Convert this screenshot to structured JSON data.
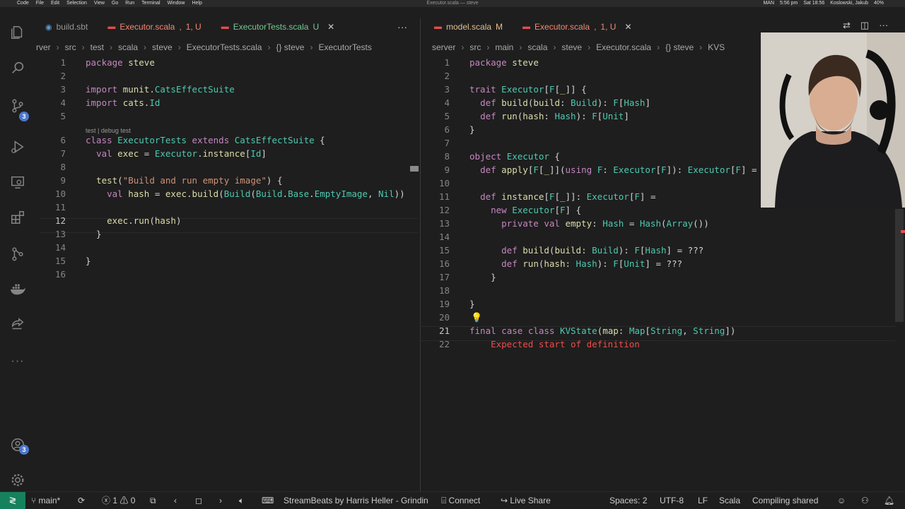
{
  "macbar": {
    "app": "Code",
    "menus": [
      "File",
      "Edit",
      "Selection",
      "View",
      "Go",
      "Run",
      "Terminal",
      "Window",
      "Help"
    ],
    "window_title": "Executor.scala — steve",
    "tray": [
      "MAN",
      "5:56 pm",
      "Sat 18:56",
      "Koslowski, Jakub",
      "40%"
    ]
  },
  "left_editor": {
    "tabs": [
      {
        "label": "build.sbt",
        "icon": "sbt-icon",
        "color": "#969696"
      },
      {
        "label": "Executor.scala",
        "status": "1, U",
        "color": "#f48771"
      },
      {
        "label": "ExecutorTests.scala",
        "status": "U",
        "color": "#73c991"
      }
    ],
    "breadcrumb": [
      "rver",
      "src",
      "test",
      "scala",
      "steve",
      "ExecutorTests.scala",
      "{} steve",
      "ExecutorTests"
    ],
    "codelens": "test | debug test",
    "lines": [
      {
        "n": "1",
        "text": "package steve"
      },
      {
        "n": "2",
        "text": ""
      },
      {
        "n": "3",
        "text": "import munit.CatsEffectSuite"
      },
      {
        "n": "4",
        "text": "import cats.Id"
      },
      {
        "n": "5",
        "text": ""
      },
      {
        "n": "6",
        "text": "class ExecutorTests extends CatsEffectSuite {"
      },
      {
        "n": "7",
        "text": "  val exec = Executor.instance[Id]"
      },
      {
        "n": "8",
        "text": ""
      },
      {
        "n": "9",
        "text": "  test(\"Build and run empty image\") {"
      },
      {
        "n": "10",
        "text": "    val hash = exec.build(Build(Build.Base.EmptyImage, Nil))"
      },
      {
        "n": "11",
        "text": ""
      },
      {
        "n": "12",
        "text": "    exec.run(hash)"
      },
      {
        "n": "13",
        "text": "  }"
      },
      {
        "n": "14",
        "text": ""
      },
      {
        "n": "15",
        "text": "}"
      },
      {
        "n": "16",
        "text": ""
      }
    ]
  },
  "right_editor": {
    "tabs": [
      {
        "label": "model.scala",
        "status": "M",
        "color": "#e2c08d"
      },
      {
        "label": "Executor.scala",
        "status": "1, U",
        "color": "#f48771"
      }
    ],
    "breadcrumb": [
      "server",
      "src",
      "main",
      "scala",
      "steve",
      "Executor.scala",
      "{} steve",
      "KVS"
    ],
    "lines": [
      {
        "n": "1",
        "text": "package steve"
      },
      {
        "n": "2",
        "text": ""
      },
      {
        "n": "3",
        "text": "trait Executor[F[_]] {"
      },
      {
        "n": "4",
        "text": "  def build(build: Build): F[Hash]"
      },
      {
        "n": "5",
        "text": "  def run(hash: Hash): F[Unit]"
      },
      {
        "n": "6",
        "text": "}"
      },
      {
        "n": "7",
        "text": ""
      },
      {
        "n": "8",
        "text": "object Executor {"
      },
      {
        "n": "9",
        "text": "  def apply[F[_]](using F: Executor[F]): Executor[F] ="
      },
      {
        "n": "10",
        "text": ""
      },
      {
        "n": "11",
        "text": "  def instance[F[_]]: Executor[F] ="
      },
      {
        "n": "12",
        "text": "    new Executor[F] {"
      },
      {
        "n": "13",
        "text": "      private val empty: Hash = Hash(Array())"
      },
      {
        "n": "14",
        "text": ""
      },
      {
        "n": "15",
        "text": "      def build(build: Build): F[Hash] = ???"
      },
      {
        "n": "16",
        "text": "      def run(hash: Hash): F[Unit] = ???"
      },
      {
        "n": "17",
        "text": "    }"
      },
      {
        "n": "18",
        "text": ""
      },
      {
        "n": "19",
        "text": "}"
      },
      {
        "n": "20",
        "text": ""
      },
      {
        "n": "21",
        "text": "final case class KVState(map: Map[String, String])"
      },
      {
        "n": "22",
        "text": "    Expected start of definition"
      }
    ]
  },
  "activity_badges": {
    "scm": "3",
    "accounts": "3"
  },
  "status": {
    "branch": "main*",
    "errors": "1",
    "warnings": "0",
    "music": "StreamBeats by Harris Heller - Grindin",
    "connect": "Connect",
    "live_share": "Live Share",
    "spaces": "Spaces: 2",
    "encoding": "UTF-8",
    "eol": "LF",
    "language": "Scala",
    "compiling": "Compiling shared"
  },
  "colors": {
    "accent": "#16825d",
    "badge": "#4d78cc",
    "error": "#f14c4c"
  }
}
